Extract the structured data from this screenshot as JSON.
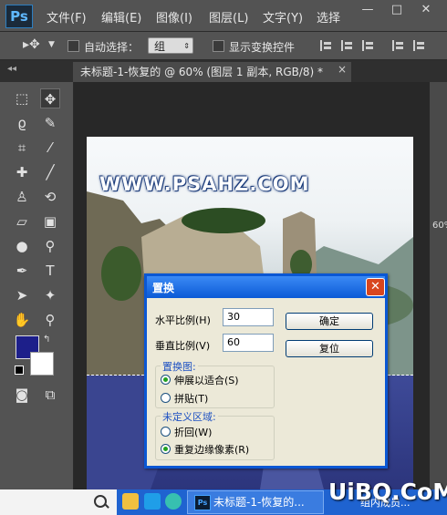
{
  "app": {
    "logo": "Ps",
    "menu": [
      "文件(F)",
      "编辑(E)",
      "图像(I)",
      "图层(L)",
      "文字(Y)",
      "选择"
    ],
    "window_controls": [
      "—",
      "□",
      "✕"
    ]
  },
  "options_bar": {
    "auto_select_label": "自动选择：",
    "auto_select_value": "组",
    "show_transform_label": "显示变换控件"
  },
  "document_tab": {
    "title": "未标题-1-恢复的 @ 60% (图层 1 副本, RGB/8) *",
    "close": "×"
  },
  "canvas": {
    "watermark": "WWW.PSAHZ.COM",
    "zoom_fragment": "60%"
  },
  "toolbar": {
    "foreground_color": "#1d1f8a",
    "background_color": "#ffffff"
  },
  "dialog": {
    "title": "置换",
    "close": "✕",
    "horizontal_scale_label": "水平比例(H)",
    "horizontal_scale_value": "30",
    "vertical_scale_label": "垂直比例(V)",
    "vertical_scale_value": "60",
    "ok_button": "确定",
    "reset_button": "复位",
    "displacement_map": {
      "title": "置换图:",
      "options": [
        "伸展以适合(S)",
        "拼贴(T)"
      ],
      "selected": 0
    },
    "undefined_areas": {
      "title": "未定义区域:",
      "options": [
        "折回(W)",
        "重复边缘像素(R)"
      ],
      "selected": 1
    }
  },
  "taskbar": {
    "photoshop_task": "未标题-1-恢复的...",
    "fragment": "组内成员..."
  },
  "site_logo": "UiBQ.CoM"
}
